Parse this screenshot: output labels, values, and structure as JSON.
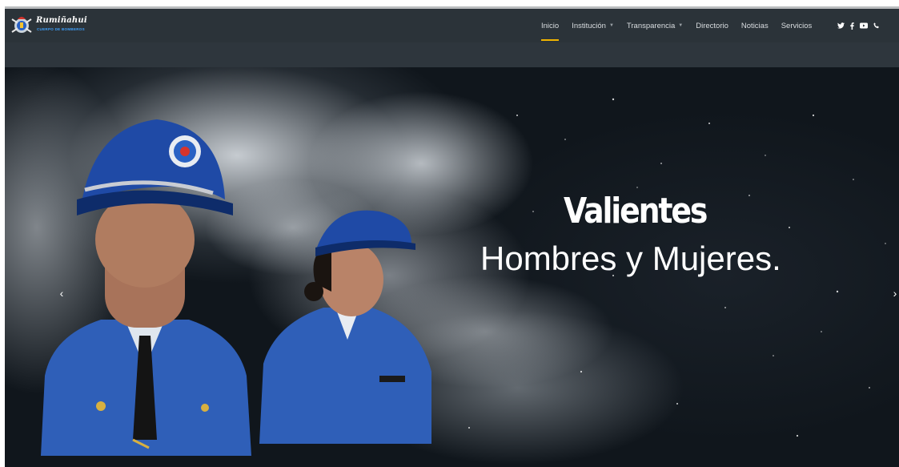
{
  "brand": {
    "name": "Rumiñahui",
    "tagline": "CUERPO DE BOMBEROS"
  },
  "nav": {
    "items": [
      {
        "label": "Inicio",
        "active": true,
        "dropdown": false
      },
      {
        "label": "Institución",
        "active": false,
        "dropdown": true
      },
      {
        "label": "Transparencia",
        "active": false,
        "dropdown": true
      },
      {
        "label": "Directorio",
        "active": false,
        "dropdown": false
      },
      {
        "label": "Noticias",
        "active": false,
        "dropdown": false
      },
      {
        "label": "Servicios",
        "active": false,
        "dropdown": false
      }
    ],
    "caret": "▼",
    "social": [
      "twitter-icon",
      "facebook-icon",
      "youtube-icon",
      "phone-icon"
    ]
  },
  "hero": {
    "title": "Valientes",
    "subtitle": "Hombres y Mujeres.",
    "prev_arrow": "‹",
    "next_arrow": "›"
  },
  "colors": {
    "navbar_bg": "#2b3339",
    "header_bg": "#2e363d",
    "accent": "#f0b400",
    "uniform_blue": "#2f5fb8"
  }
}
